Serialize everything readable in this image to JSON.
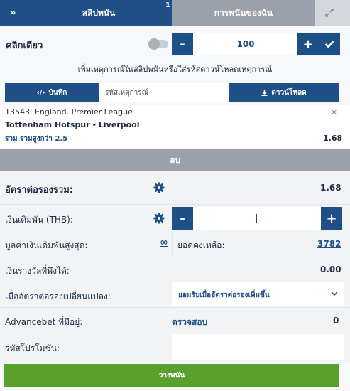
{
  "tabs": {
    "bet_slip_label": "สลิปพนัน",
    "bet_slip_count": "1",
    "my_bets_label": "การพนันของฉัน"
  },
  "quick_bet": {
    "label": "คลิกเดียว",
    "amount": "100",
    "toggle_on": false
  },
  "hint": "เพิ่มเหตุการณ์ในสลิปพนันหรือใส่รหัสดาวน์โหลดเหตุการณ์",
  "actions": {
    "save_label": "บันทึก",
    "code_placeholder": "รหัสเหตุการณ์",
    "download_label": "ดาวน์โหลด"
  },
  "selection": {
    "league": "13543. England. Premier League",
    "event": "Tottenham Hotspur - Liverpool",
    "market": "รวม รวมสูงกว่า 2.5",
    "odds": "1.68",
    "close_symbol": "×"
  },
  "remove_label": "ลบ",
  "summary": {
    "total_odds_label": "อัตราต่อรองรวม:",
    "total_odds_value": "1.68",
    "stake_label": "เงินเดิมพัน (THB):",
    "max_stake_label": "มูลค่าเงินเดิมพันสูงสุด:",
    "max_stake_value": "∞",
    "balance_label": "ยอดคงเหลือ:",
    "balance_value": "3782",
    "winnings_label": "เงินรางวัลที่พึงได้:",
    "winnings_value": "0.00",
    "odds_change_label": "เมื่ออัตราต่อรองเปลี่ยนแปลง:",
    "odds_change_value": "ยอมรับเมื่ออัตราต่อรองเพิ่มขึ้น",
    "advancebet_label": "Advancebet ที่มีอยู่:",
    "advancebet_link": "ตรวจสอบ",
    "advancebet_value": "0",
    "promo_label": "รหัสโปรโมชัน:"
  },
  "place_bet_label": "วางพนัน",
  "icons": {
    "collapse": "double-chevron-right-icon",
    "expand": "arrows-diagonal-icon",
    "gear": "gear-icon",
    "save": "code-brackets-icon",
    "download": "download-icon",
    "confirm": "check-icon"
  },
  "colors": {
    "primary": "#1e4f86",
    "inactive_tab": "#9aa1ab",
    "place_bet": "#5aa02c"
  }
}
